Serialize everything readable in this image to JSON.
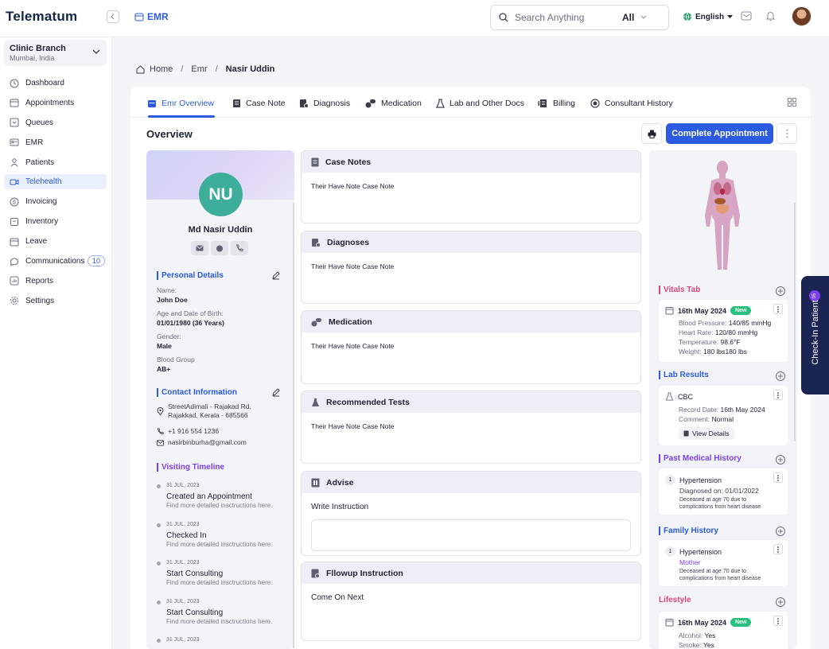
{
  "app": {
    "logo": "Telematum",
    "module": "EMR"
  },
  "search": {
    "placeholder": "Search Anything",
    "scope": "All"
  },
  "language": "English",
  "branch": {
    "name": "Clinic Branch",
    "city": "Mumbai, India"
  },
  "sidebar": {
    "items": [
      {
        "label": "Dashboard",
        "icon": "clock-icon"
      },
      {
        "label": "Appointments",
        "icon": "calendar-icon"
      },
      {
        "label": "Queues",
        "icon": "queue-icon"
      },
      {
        "label": "EMR",
        "icon": "id-card-icon"
      },
      {
        "label": "Patients",
        "icon": "users-icon"
      },
      {
        "label": "Telehealth",
        "icon": "video-icon",
        "active": true
      },
      {
        "label": "Invoicing",
        "icon": "dollar-icon"
      },
      {
        "label": "Inventory",
        "icon": "box-icon"
      },
      {
        "label": "Leave",
        "icon": "calendar-icon"
      },
      {
        "label": "Communications",
        "icon": "chat-icon",
        "badge": "10"
      },
      {
        "label": "Reports",
        "icon": "chart-icon"
      },
      {
        "label": "Settings",
        "icon": "gear-icon"
      }
    ]
  },
  "breadcrumb": {
    "home": "Home",
    "section": "Emr",
    "current": "Nasir Uddin"
  },
  "tabs": [
    "Emr Overview",
    "Case Note",
    "Diagnosis",
    "Medication",
    "Lab and Other Docs",
    "Billing",
    "Consultant History"
  ],
  "overview": {
    "title": "Overview",
    "complete_button": "Complete Appointment"
  },
  "patient": {
    "initials": "NU",
    "name": "Md Nasir Uddin",
    "personal_heading": "Personal Details",
    "fields": [
      {
        "label": "Name:",
        "value": "John Doe"
      },
      {
        "label": "Age and Date of Birth:",
        "value": "01/01/1980 (36 Years)"
      },
      {
        "label": "Gender:",
        "value": "Male"
      },
      {
        "label": "Blood Group",
        "value": "AB+"
      }
    ],
    "contact_heading": "Contact Information",
    "address_line1": "StreetAdimali - Rajakad Rd,",
    "address_line2": "Rajakkad, Kerala - 685566",
    "phone": "+1 916 554 1236",
    "email": "nasirbinburha@gmail.com",
    "timeline_heading": "Visiting Timeline",
    "timeline": [
      {
        "date": "31 JUL, 2023",
        "title": "Created an Appointment",
        "desc": "Find more detailed insctructions here."
      },
      {
        "date": "31 JUL, 2023",
        "title": "Checked In",
        "desc": "Find more detailed insctructions here."
      },
      {
        "date": "31 JUL, 2023",
        "title": "Start Consulting",
        "desc": "Find more detailed insctructions here."
      },
      {
        "date": "31 JUL, 2023",
        "title": "Start Consulting",
        "desc": "Find more detailed insctructions here."
      },
      {
        "date": "31 JUL, 2023",
        "title": "",
        "desc": ""
      }
    ]
  },
  "panels": {
    "case_notes": {
      "title": "Case Notes",
      "body": "Their Have Note Case Note"
    },
    "diagnoses": {
      "title": "Diagnoses",
      "body": "Their Have Note Case Note"
    },
    "medication": {
      "title": "Medication",
      "body": "Their Have Note Case Note"
    },
    "tests": {
      "title": "Recommended Tests",
      "body": "Their Have Note Case Note"
    },
    "advise": {
      "title": "Advise",
      "label": "Write Instruction"
    },
    "followup": {
      "title": "Fllowup Instruction",
      "body": "Come On Next"
    }
  },
  "vitals": {
    "heading": "Vitals Tab",
    "date": "16th May 2024",
    "badge": "New",
    "bp_label": "Blood Pressure:",
    "bp": "140/85 mmHg",
    "hr_label": "Heart Rate:",
    "hr": "120/80 mmHg",
    "temp_label": "Temperature:",
    "temp": "98.6°F",
    "weight_label": "Weight:",
    "weight": "180 lbs180 lbs"
  },
  "lab": {
    "heading": "Lab Results",
    "name": "CBC",
    "record_label": "Record Date:",
    "record": "16th May 2024",
    "comment_label": "Comment:",
    "comment": "Normal",
    "view": "View Details"
  },
  "past_history": {
    "heading": "Past Medical History",
    "num": "1",
    "title": "Hypertension",
    "diag_label": "Diagnosed on:",
    "diag": "01/01/2022",
    "note": "Deceased at age 70 due to complications from heart disease"
  },
  "family_history": {
    "heading": "Family History",
    "num": "1",
    "title": "Hypertension",
    "relation": "Mother",
    "note": "Deceased at age 70 due to complications from heart disease"
  },
  "lifestyle": {
    "heading": "Lifestyle",
    "date": "16th May 2024",
    "badge": "New",
    "alcohol_label": "Alcohol:",
    "alcohol": "Yes",
    "smoke_label": "Smoke:",
    "smoke": "Yes"
  },
  "checkin": {
    "label": "Check-In Patient",
    "count": "05"
  },
  "colors": {
    "primary": "#2c5ae0",
    "navy": "#1b2553",
    "purple": "#7b3ff2",
    "pink": "#e0457b",
    "green": "#27c07d",
    "avatar": "#3cae9a"
  }
}
